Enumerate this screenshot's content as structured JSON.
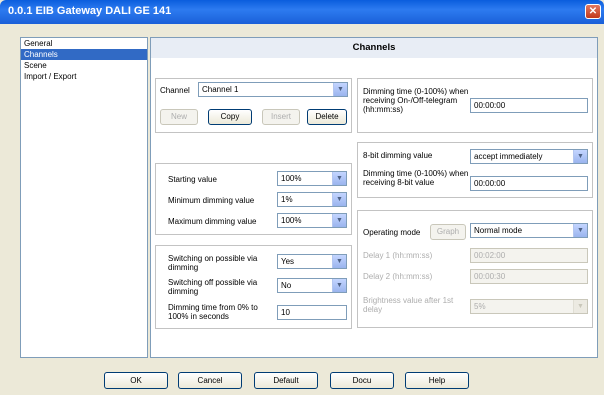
{
  "window": {
    "title": "0.0.1  EIB Gateway DALI GE 141",
    "close_glyph": "✕"
  },
  "nav": {
    "items": [
      "General",
      "Channels",
      "Scene",
      "Import / Export"
    ],
    "selected": 1
  },
  "page": {
    "title": "Channels",
    "channel": {
      "label": "Channel",
      "value": "Channel 1"
    },
    "buttons": {
      "new": "New",
      "copy": "Copy",
      "insert": "Insert",
      "delete": "Delete"
    },
    "dim_values": {
      "starting_label": "Starting value",
      "starting_value": "100%",
      "min_label": "Minimum dimming value",
      "min_value": "1%",
      "max_label": "Maximum dimming value",
      "max_value": "100%"
    },
    "switching": {
      "on_label": "Switching on possible via dimming",
      "on_value": "Yes",
      "off_label": "Switching off possible via dimming",
      "off_value": "No",
      "time_label": "Dimming time from 0% to 100% in seconds",
      "time_value": "10"
    },
    "on_off": {
      "label": "Dimming time (0-100%) when receiving On-/Off-telegram (hh:mm:ss)",
      "value": "00:00:00"
    },
    "eight_bit": {
      "mode_label": "8-bit dimming value",
      "mode_value": "accept immediately",
      "time_label": "Dimming time (0-100%) when receiving 8-bit value",
      "time_value": "00:00:00"
    },
    "operating": {
      "label": "Operating mode",
      "graph_button": "Graph",
      "mode_value": "Normal mode",
      "delay1_label": "Delay 1 (hh:mm:ss)",
      "delay1_value": "00:02:00",
      "delay2_label": "Delay 2 (hh:mm:ss)",
      "delay2_value": "00:00:30",
      "brightness_label": "Brightness value after 1st delay",
      "brightness_value": "5%"
    }
  },
  "footer": {
    "ok": "OK",
    "cancel": "Cancel",
    "default": "Default",
    "docu": "Docu",
    "help": "Help"
  }
}
